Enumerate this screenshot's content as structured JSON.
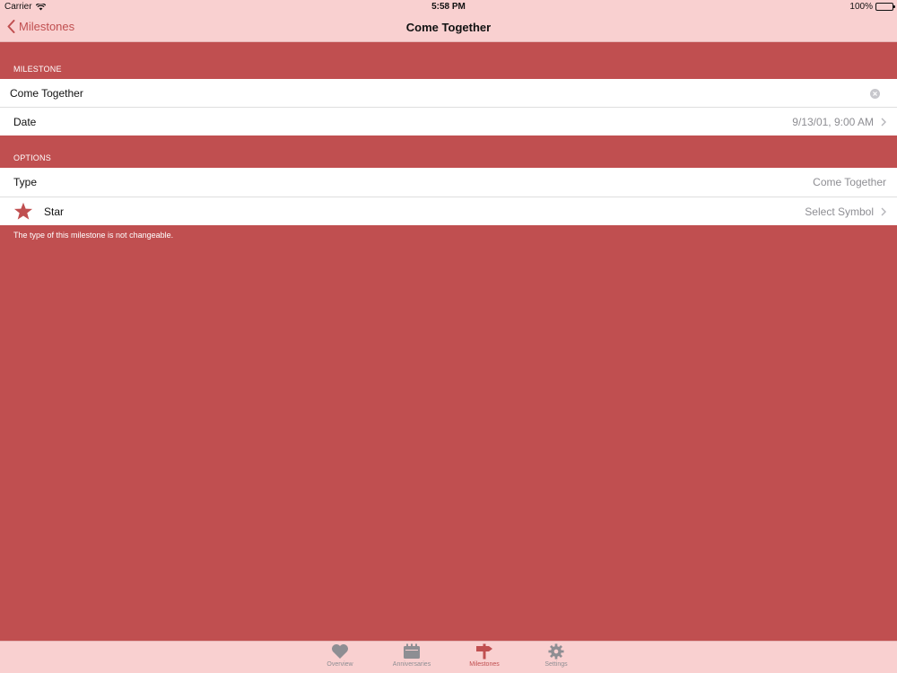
{
  "status_bar": {
    "carrier": "Carrier",
    "time": "5:58 PM",
    "battery": "100%"
  },
  "nav": {
    "back_label": "Milestones",
    "title": "Come Together"
  },
  "sections": {
    "milestone": {
      "header": "MILESTONE",
      "name_value": "Come Together",
      "date_label": "Date",
      "date_value": "9/13/01, 9:00 AM"
    },
    "options": {
      "header": "OPTIONS",
      "type_label": "Type",
      "type_value": "Come Together",
      "symbol_label": "Star",
      "symbol_value": "Select Symbol",
      "symbol_icon": "star-icon",
      "footer": "The type of this milestone is not changeable."
    }
  },
  "tabs": [
    {
      "label": "Overview",
      "icon": "heart-icon",
      "active": false
    },
    {
      "label": "Anniversaries",
      "icon": "calendar-icon",
      "active": false
    },
    {
      "label": "Milestones",
      "icon": "signpost-icon",
      "active": true
    },
    {
      "label": "Settings",
      "icon": "gear-icon",
      "active": false
    }
  ],
  "colors": {
    "accent": "#c04f50",
    "bars": "#f9d0d0",
    "inactive_tab": "#8e8e93"
  }
}
